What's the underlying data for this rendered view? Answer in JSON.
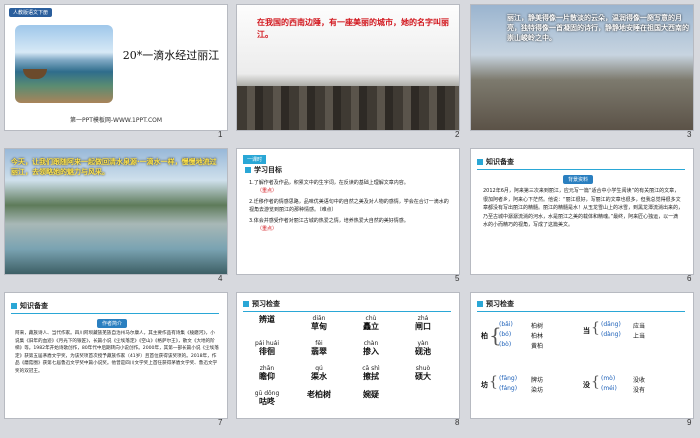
{
  "slides": [
    {
      "num": "1",
      "tag": "人教版语文下册",
      "title": "20*一滴水经过丽江",
      "site": "第一PPT模板网-WWW.1PPT.COM"
    },
    {
      "num": "2",
      "text": "在我国的西南边陲，有一座美丽的城市，她的名字叫丽江。"
    },
    {
      "num": "3",
      "text": "丽江，静美得像一片散淡的云朵，温润得像一阕写意的月亮，独特得像一首凝固的诗行，静静地安睡在祖国大西南的崇山峻岭之中。"
    },
    {
      "num": "4",
      "text": "今天，让我们跟随阿来一起做回清水泉源·一滴水一样，慢慢地流过丽江，去领略她的魅力与风采。"
    },
    {
      "num": "5",
      "tab": "一课时",
      "heading": "学习目标",
      "items": [
        "1.了解作者及作品，积累文中的生字词，在反读的基础上理解文章内容。",
        "（重点）",
        "2.迁移作者的情感思路，品味优美语句中的自然之美及对人物的感情，学会在合订一滴水的视角去游览到丽江的那种情感。（难点）",
        "3.体会并感受作者对丽江古城的热爱之情，培养热爱大自然的美好情感。",
        "（重点）"
      ]
    },
    {
      "num": "6",
      "heading": "知识备查",
      "badge": "背景资料",
      "para": "2012年6月，阿来第三次来到丽江，应元写一篇“适合中小学生阅读”的有关丽江的文章，很加阿者乡，阿来心下茫然。他说：“丽江很好，写丽江的文章也很多，但我总觉得很多文章都没有写出丽江的精髓。丽江的精髓是水！从玉龙雪山上的冰雪，到黑龙潭流淌出来的，乃至古城中潺潺流淌的河水，水是丽江之美的载体和精魂。”最终，阿来匠心独运，以一滴水的小而精巧的视角，写成了这篇美文。"
    },
    {
      "num": "7",
      "heading": "知识备查",
      "badge": "作者简介",
      "para": "阿来，藏族诗人、当代作家。四川阿坝藏族羌族自治州马尔康人，其主要作品有诗集《棱磨河》，小说集《旧年的血迹》《月光下的银匠》，长篇小说《尘埃落定》《空山》《格萨尔王》，散文《大地的阶梯》等。1982年开始诗歌创作，80年代中后期转向小说创作。2000年，其第一部长篇小说《尘埃落定》获第五届茅盾文学奖，为该奖项首次授予藏族作家（41岁）且首位获得该奖项的。2018年，作品《蘑菇圈》获第七届鲁迅文学奖中篇小说奖。他曾是四川文学奖上首任获得茅盾文学奖、鲁迅文学奖的双冠王。",
      "bold": "阿来"
    },
    {
      "num": "8",
      "heading": "预习检查",
      "cells": [
        {
          "py": "",
          "hz": "辨道"
        },
        {
          "py": "diān",
          "hz": "草甸"
        },
        {
          "py": "chù",
          "hz": "矗立"
        },
        {
          "py": "zhá",
          "hz": "闸口"
        },
        {
          "py": "pái huái",
          "hz": "徘徊"
        },
        {
          "py": "fěi",
          "hz": "翡翠"
        },
        {
          "py": "chàn",
          "hz": "掺入"
        },
        {
          "py": "yàn",
          "hz": "砚池"
        },
        {
          "py": "zhān",
          "hz": "瞻仰"
        },
        {
          "py": "qú",
          "hz": "渠水"
        },
        {
          "py": "cā shì",
          "hz": "擦拭"
        },
        {
          "py": "shuò",
          "hz": "硕大"
        },
        {
          "py": "gū dōng",
          "hz": "咕咚"
        },
        {
          "py": "",
          "hz": "老柏树"
        },
        {
          "py": "",
          "hz": "婉疑"
        },
        {
          "py": "",
          "hz": ""
        }
      ]
    },
    {
      "num": "9",
      "heading": "预习检查",
      "groups": [
        {
          "ch": "柏",
          "items": [
            {
              "py": "(bǎi)",
              "wd": "柏树"
            },
            {
              "py": "(bó)",
              "wd": "柏林"
            },
            {
              "py": "(bò)",
              "wd": "黄柏"
            }
          ]
        },
        {
          "ch": "当",
          "items": [
            {
              "py": "(dāng)",
              "wd": "应当"
            },
            {
              "py": "(dàng)",
              "wd": "上当"
            }
          ]
        },
        {
          "ch": "坊",
          "items": [
            {
              "py": "(fāng)",
              "wd": "牌坊"
            },
            {
              "py": "(fáng)",
              "wd": "染坊"
            }
          ]
        },
        {
          "ch": "没",
          "items": [
            {
              "py": "(mò)",
              "wd": "没收"
            },
            {
              "py": "(méi)",
              "wd": "没有"
            }
          ]
        }
      ]
    }
  ]
}
